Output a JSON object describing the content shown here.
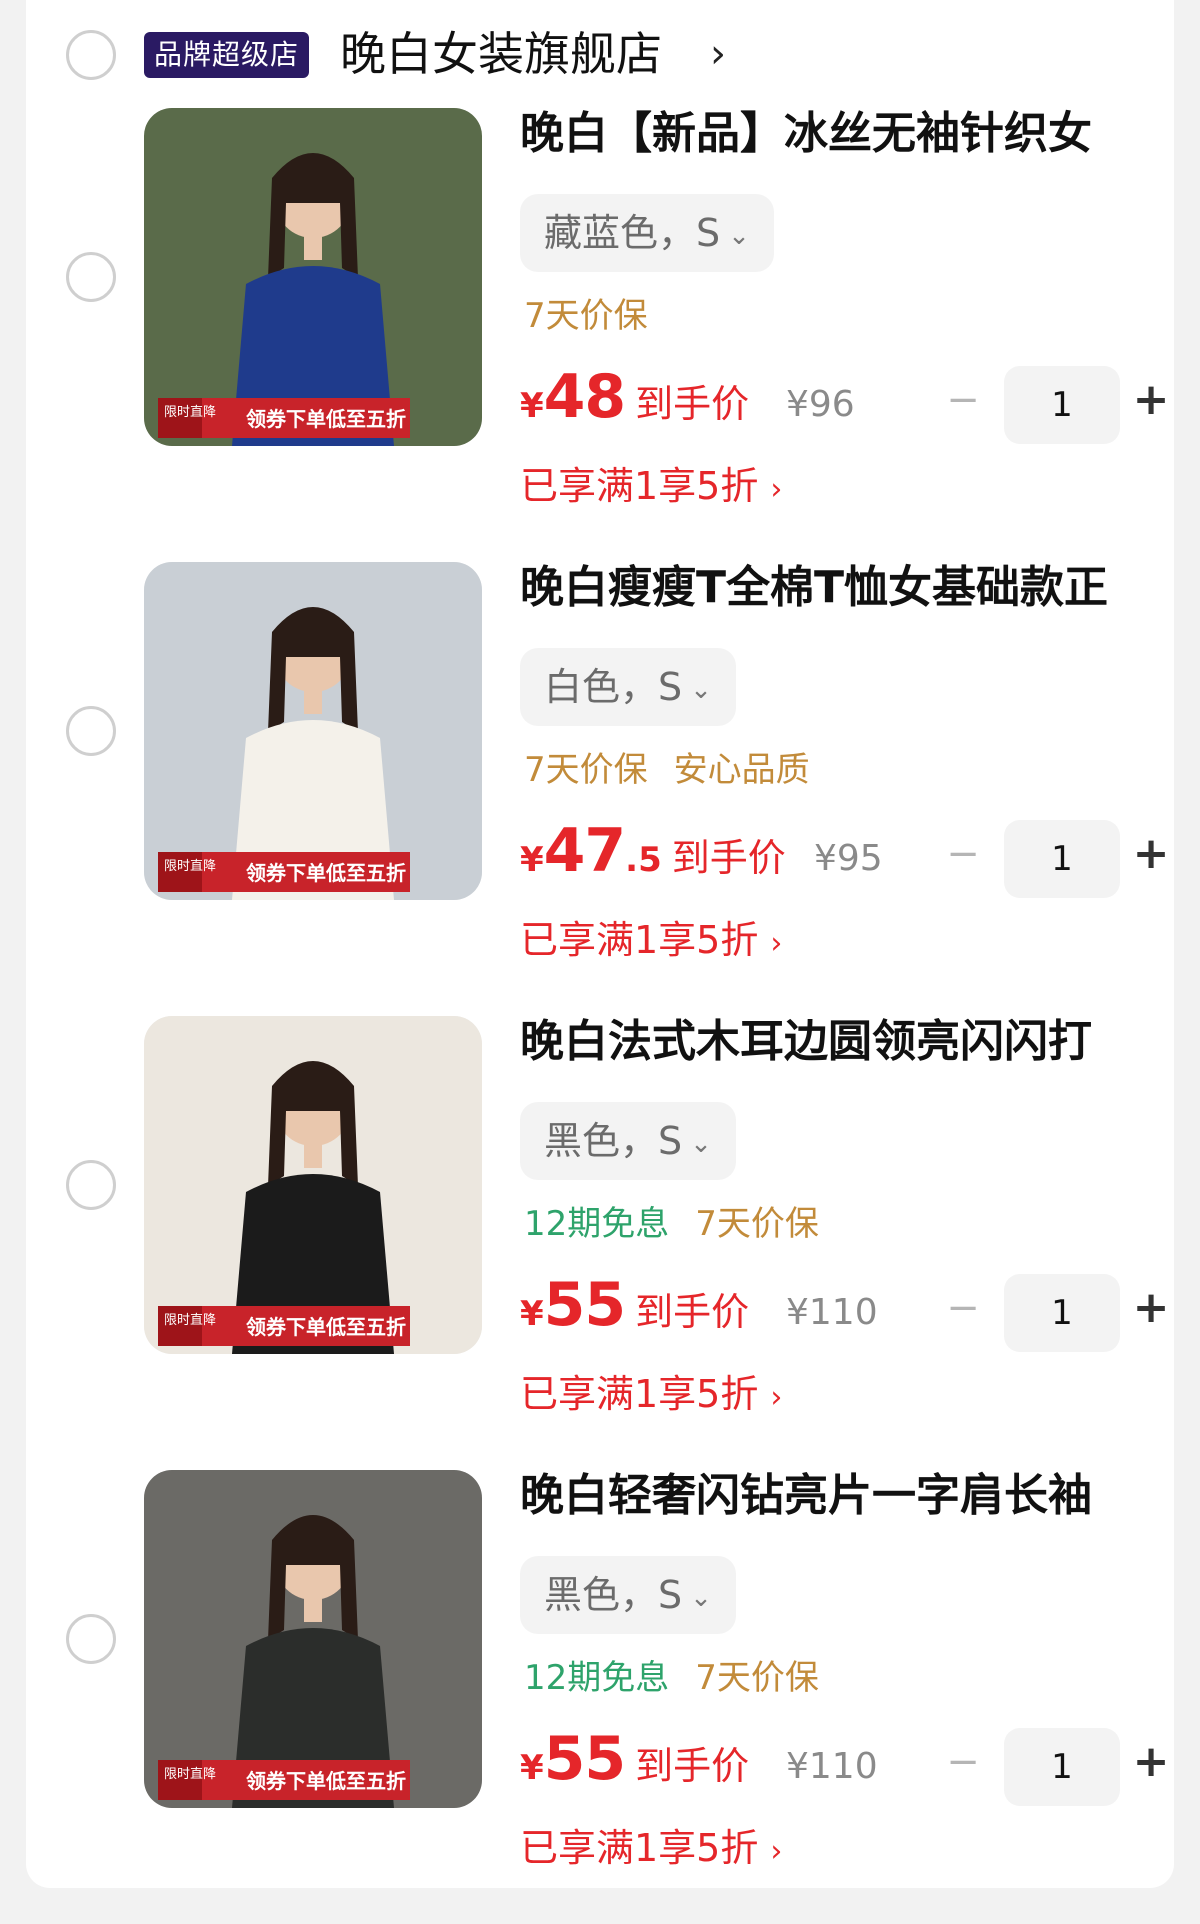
{
  "shop": {
    "badge": "品牌超级店",
    "name": "晚白女装旗舰店",
    "chevron": "›"
  },
  "items": [
    {
      "title": "晚白【新品】冰丝无袖针织女",
      "sku": "藏蓝色，S",
      "tags": [
        {
          "text": "7天价保",
          "color": "orange"
        }
      ],
      "price_yen": "¥",
      "price_int": "48",
      "price_dec": "",
      "price_label": "到手价",
      "orig_price": "¥96",
      "qty": "1",
      "promo": "已享满1享5折",
      "image_banner": "领券下单低至五折",
      "image_badge": "限时直降",
      "shirt_color": "#1f3b8c",
      "bg_color": "#5a6b4a"
    },
    {
      "title": "晚白瘦瘦T全棉T恤女基础款正",
      "sku": "白色，S",
      "tags": [
        {
          "text": "7天价保",
          "color": "orange"
        },
        {
          "text": "安心品质",
          "color": "orange"
        }
      ],
      "price_yen": "¥",
      "price_int": "47",
      "price_dec": ".5",
      "price_label": "到手价",
      "orig_price": "¥95",
      "qty": "1",
      "promo": "已享满1享5折",
      "image_banner": "领券下单低至五折",
      "image_badge": "限时直降",
      "shirt_color": "#f4f1ea",
      "bg_color": "#c9cfd5"
    },
    {
      "title": "晚白法式木耳边圆领亮闪闪打",
      "sku": "黑色，S",
      "tags": [
        {
          "text": "12期免息",
          "color": "green"
        },
        {
          "text": "7天价保",
          "color": "orange"
        }
      ],
      "price_yen": "¥",
      "price_int": "55",
      "price_dec": "",
      "price_label": "到手价",
      "orig_price": "¥110",
      "qty": "1",
      "promo": "已享满1享5折",
      "image_banner": "领券下单低至五折",
      "image_badge": "限时直降",
      "shirt_color": "#1b1b1b",
      "bg_color": "#ece7df"
    },
    {
      "title": "晚白轻奢闪钻亮片一字肩长袖",
      "sku": "黑色，S",
      "tags": [
        {
          "text": "12期免息",
          "color": "green"
        },
        {
          "text": "7天价保",
          "color": "orange"
        }
      ],
      "price_yen": "¥",
      "price_int": "55",
      "price_dec": "",
      "price_label": "到手价",
      "orig_price": "¥110",
      "qty": "1",
      "promo": "已享满1享5折",
      "image_banner": "领券下单低至五折",
      "image_badge": "限时直降",
      "shirt_color": "#2b2d2b",
      "bg_color": "#6b6a66"
    }
  ],
  "controls": {
    "minus": "−",
    "plus": "+",
    "sku_chevron": "⌄",
    "promo_chevron": "›"
  },
  "colors": {
    "price_red": "#e5262a",
    "tag_orange": "#c28b3a",
    "tag_green": "#2ea36b",
    "shop_badge_bg": "#2a1a63"
  }
}
